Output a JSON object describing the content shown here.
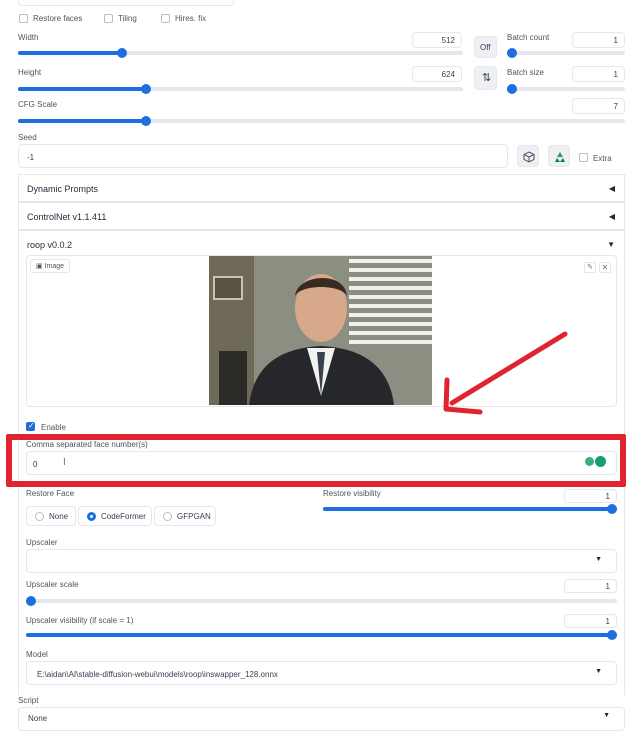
{
  "checkboxes": {
    "restore_faces": "Restore faces",
    "tiling": "Tiling",
    "hires_fix": "Hires. fix"
  },
  "width": {
    "label": "Width",
    "value": "512",
    "fraction": 0.26
  },
  "height": {
    "label": "Height",
    "value": "624",
    "fraction": 0.3
  },
  "off_button": "Off",
  "batch_count": {
    "label": "Batch count",
    "value": "1"
  },
  "batch_size": {
    "label": "Batch size",
    "value": "1"
  },
  "cfg": {
    "label": "CFG Scale",
    "value": "7",
    "fraction": 0.21
  },
  "seed": {
    "label": "Seed",
    "value": "-1",
    "extra_label": "Extra"
  },
  "accordions": {
    "dynamic_prompts": "Dynamic Prompts",
    "controlnet": "ControlNet v1.1.411",
    "roop": "roop v0.0.2"
  },
  "image_panel": {
    "label": "Image"
  },
  "enable_label": "Enable",
  "face_numbers": {
    "label": "Comma separated face number(s)",
    "value": "0"
  },
  "restore_face": {
    "label": "Restore Face",
    "options": [
      "None",
      "CodeFormer",
      "GFPGAN"
    ],
    "selected": "CodeFormer"
  },
  "restore_visibility": {
    "label": "Restore visibility",
    "value": "1",
    "fraction": 1.0
  },
  "upscaler": {
    "label": "Upscaler",
    "value": ""
  },
  "upscaler_scale": {
    "label": "Upscaler scale",
    "value": "1",
    "fraction": 0.0
  },
  "upscaler_visibility": {
    "label": "Upscaler visibility (if scale = 1)",
    "value": "1",
    "fraction": 1.0
  },
  "model": {
    "label": "Model",
    "value": "E:\\aidan\\AI\\stable-diffusion-webui\\models\\roop\\inswapper_128.onnx"
  },
  "script": {
    "label": "Script",
    "value": "None"
  },
  "colors": {
    "accent": "#1d6fe0",
    "annotation": "#e0242f"
  }
}
